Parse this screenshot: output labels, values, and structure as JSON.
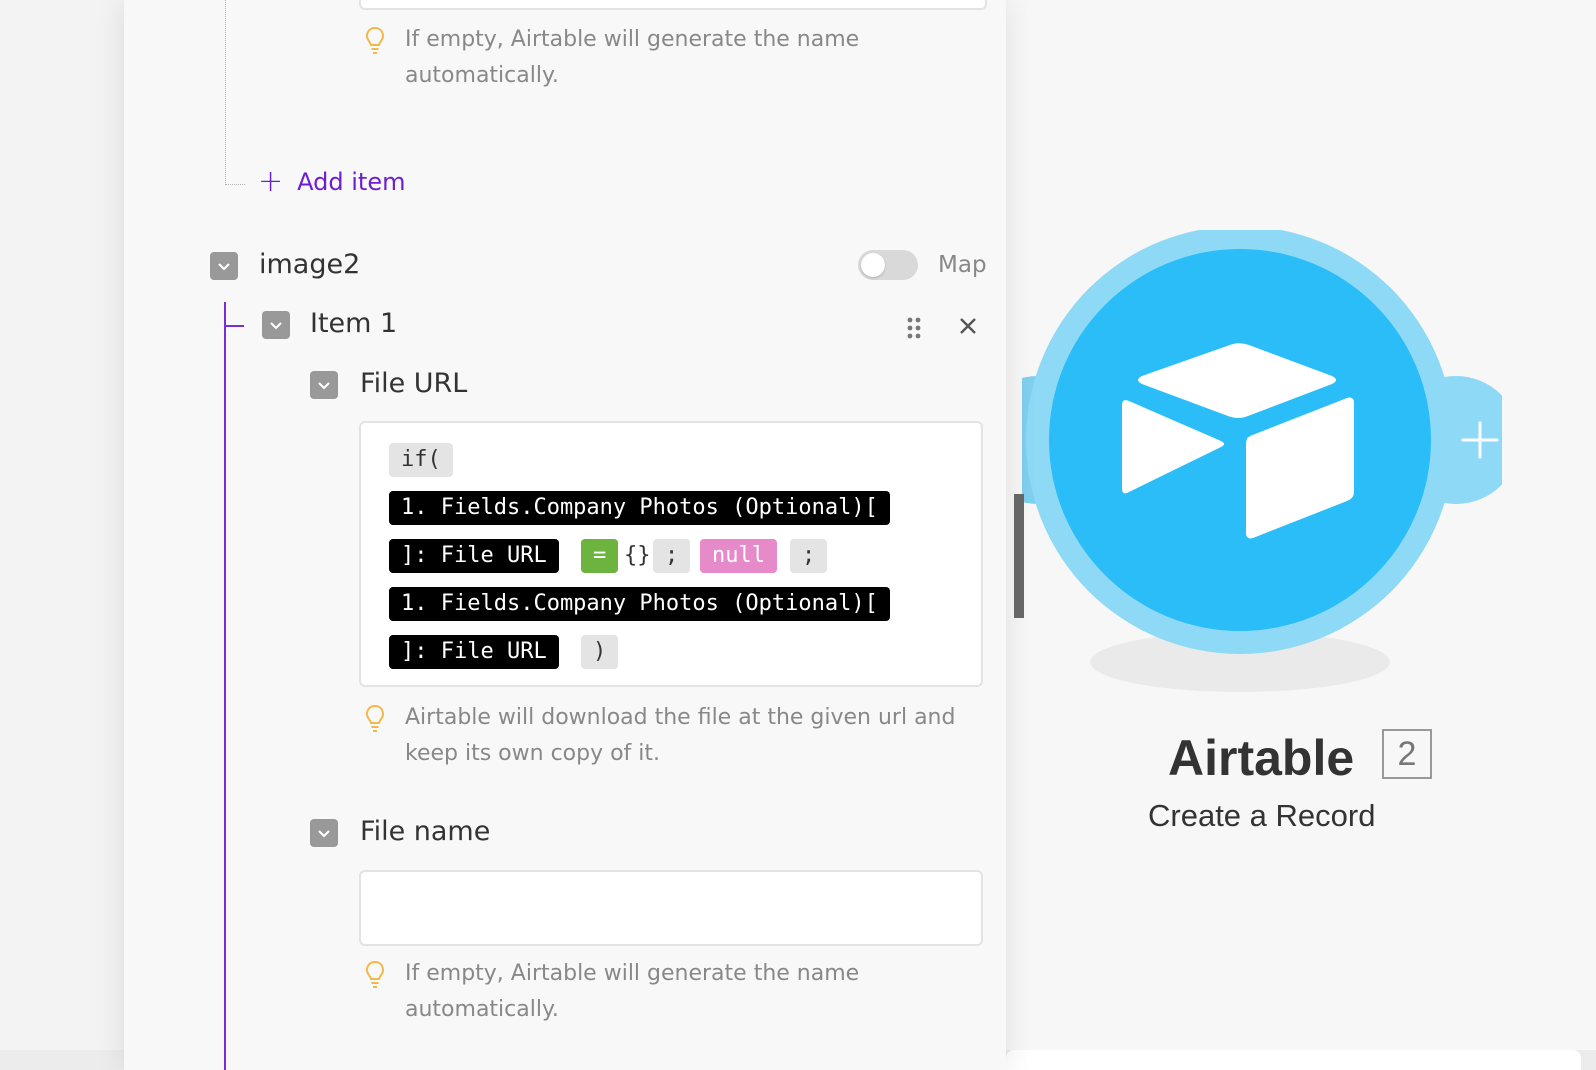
{
  "top_hint": "If empty, Airtable will generate the name automatically.",
  "add_item_label": "Add item",
  "image2": {
    "label": "image2",
    "map_label": "Map",
    "map_enabled": false
  },
  "item1": {
    "label": "Item 1"
  },
  "file_url": {
    "label": "File URL",
    "tokens": {
      "if_open": "if(",
      "field_a_line1": "1. Fields.Company Photos (Optional)[",
      "field_a_line2": "]: File URL",
      "equals": "=",
      "empty_obj": "{}",
      "semi1": ";",
      "null": "null",
      "semi2": ";",
      "field_b_line1": "1. Fields.Company Photos (Optional)[",
      "field_b_line2": "]: File URL",
      "close_paren": ")"
    },
    "hint": "Airtable will download the file at the given url and keep its own copy of it."
  },
  "file_name": {
    "label": "File name",
    "value": "",
    "hint": "If empty, Airtable will generate the name automatically."
  },
  "module": {
    "title": "Airtable",
    "badge": "2",
    "subtitle": "Create a Record",
    "icon": "airtable-logo-icon",
    "colors": {
      "outer": "#8ed9f6",
      "inner": "#2bbdf7",
      "accent": "#6e1ed1"
    }
  }
}
